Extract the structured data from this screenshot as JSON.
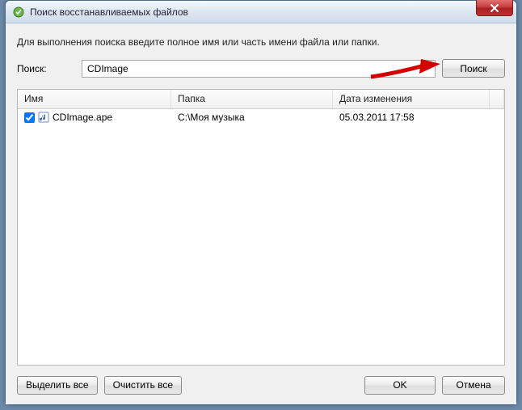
{
  "window": {
    "title": "Поиск восстанавливаемых файлов"
  },
  "instruction": "Для выполнения поиска введите полное имя или часть имени файла или папки.",
  "search": {
    "label": "Поиск:",
    "value": "CDImage",
    "button": "Поиск"
  },
  "columns": {
    "name": "Имя",
    "folder": "Папка",
    "date": "Дата изменения"
  },
  "rows": [
    {
      "checked": true,
      "name": "CDImage.ape",
      "folder": "C:\\Моя музыка",
      "date": "05.03.2011 17:58"
    }
  ],
  "buttons": {
    "selectAll": "Выделить все",
    "clearAll": "Очистить все",
    "ok": "OK",
    "cancel": "Отмена"
  }
}
